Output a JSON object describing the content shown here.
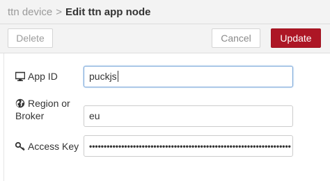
{
  "header": {
    "parent": "ttn device",
    "separator": ">",
    "title": "Edit ttn app node"
  },
  "toolbar": {
    "delete_label": "Delete",
    "cancel_label": "Cancel",
    "update_label": "Update"
  },
  "form": {
    "app_id": {
      "label": "App ID",
      "value": "puckjs",
      "icon": "monitor-icon"
    },
    "region": {
      "label_line1": "Region or",
      "label_line2": "Broker",
      "value": "eu",
      "icon": "globe-icon"
    },
    "access_key": {
      "label": "Access Key",
      "value": "•••••••••••••••••••••••••••••••••••••••••••••••••••••••••••••••••••••",
      "icon": "key-icon"
    }
  },
  "colors": {
    "accent": "#ad1625",
    "header_bg": "#f3f3f3",
    "focus_border": "#7aa7d9"
  }
}
